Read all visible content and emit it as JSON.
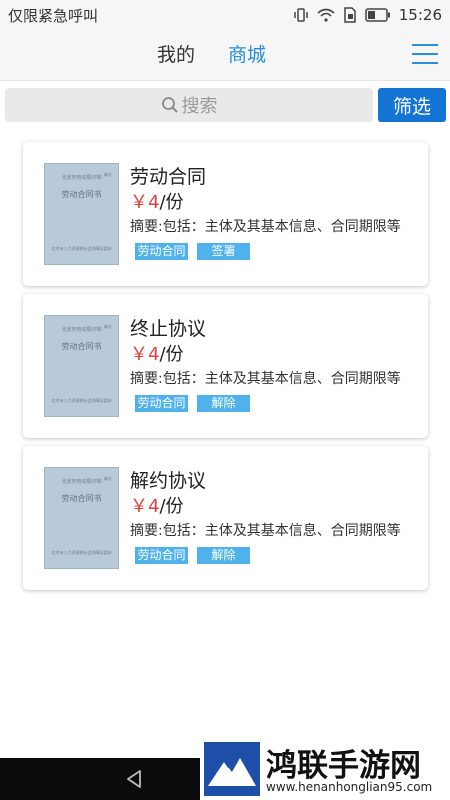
{
  "status_bar": {
    "left_text": "仅限紧急呼叫",
    "time": "15:26"
  },
  "header": {
    "tab_mine": "我的",
    "tab_mall": "商城",
    "accent_color": "#2a8ee0"
  },
  "search": {
    "placeholder": "搜索",
    "filter_label": "筛选"
  },
  "products": [
    {
      "title": "劳动合同",
      "price_currency": "￥4",
      "price_unit": "/份",
      "summary": "摘要:包括：主体及其基本信息、合同期限等",
      "tags": [
        "劳动合同",
        "签署"
      ],
      "thumb": {
        "line1": "北京市劳动局印制",
        "line2": "劳动合同书",
        "line3": "北京市人力资源和社会保障局监制",
        "corner": "编号"
      }
    },
    {
      "title": "终止协议",
      "price_currency": "￥4",
      "price_unit": "/份",
      "summary": "摘要:包括：主体及其基本信息、合同期限等",
      "tags": [
        "劳动合同",
        "解除"
      ],
      "thumb": {
        "line1": "北京市劳动局印制",
        "line2": "劳动合同书",
        "line3": "北京市人力资源和社会保障局监制",
        "corner": "编号"
      }
    },
    {
      "title": "解约协议",
      "price_currency": "￥4",
      "price_unit": "/份",
      "summary": "摘要:包括：主体及其基本信息、合同期限等",
      "tags": [
        "劳动合同",
        "解除"
      ],
      "thumb": {
        "line1": "北京市劳动局印制",
        "line2": "劳动合同书",
        "line3": "北京市人力资源和社会保障局监制",
        "corner": "编号"
      }
    }
  ],
  "icons": {
    "vibrate": "vibrate-icon",
    "wifi": "wifi-icon",
    "sim": "sim-icon",
    "battery": "battery-icon",
    "menu": "menu-icon",
    "search": "search-icon",
    "back": "back-icon"
  },
  "watermark": {
    "title": "鸿联手游网",
    "url": "www.henanhonglian95.com"
  }
}
